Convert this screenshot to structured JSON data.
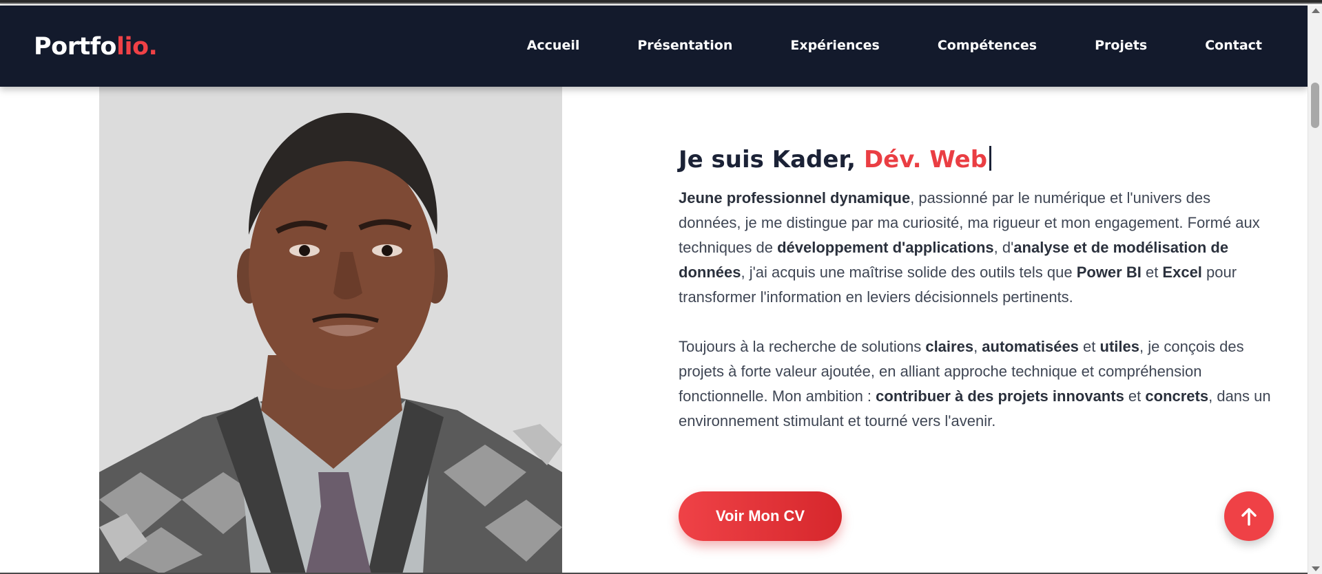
{
  "navbar": {
    "logo_main": "Portfo",
    "logo_accent": "lio.",
    "links": [
      "Accueil",
      "Présentation",
      "Expériences",
      "Compétences",
      "Projets",
      "Contact"
    ]
  },
  "hero": {
    "heading_prefix": "Je suis Kader, ",
    "heading_role": "Dév. Web",
    "paragraph1": [
      {
        "t": "Jeune professionnel dynamique",
        "b": true
      },
      {
        "t": ", passionné par le numérique et l'univers des données, je me distingue par ma curiosité, ma rigueur et mon engagement. Formé aux techniques de ",
        "b": false
      },
      {
        "t": "développement d'applications",
        "b": true
      },
      {
        "t": ", d'",
        "b": false
      },
      {
        "t": "analyse et de modélisation de données",
        "b": true
      },
      {
        "t": ", j'ai acquis une maîtrise solide des outils tels que ",
        "b": false
      },
      {
        "t": "Power BI",
        "b": true
      },
      {
        "t": " et ",
        "b": false
      },
      {
        "t": "Excel",
        "b": true
      },
      {
        "t": " pour transformer l'information en leviers décisionnels pertinents.",
        "b": false
      }
    ],
    "paragraph2": [
      {
        "t": "Toujours à la recherche de solutions ",
        "b": false
      },
      {
        "t": "claires",
        "b": true
      },
      {
        "t": ", ",
        "b": false
      },
      {
        "t": "automatisées",
        "b": true
      },
      {
        "t": " et ",
        "b": false
      },
      {
        "t": "utiles",
        "b": true
      },
      {
        "t": ", je conçois des projets à forte valeur ajoutée, en alliant approche technique et compréhension fonctionnelle. Mon ambition : ",
        "b": false
      },
      {
        "t": "contribuer à des projets innovants",
        "b": true
      },
      {
        "t": " et ",
        "b": false
      },
      {
        "t": "concrets",
        "b": true
      },
      {
        "t": ", dans un environnement stimulant et tourné vers l'avenir.",
        "b": false
      }
    ],
    "cv_button_label": "Voir Mon CV"
  },
  "icons": {
    "back_to_top": "arrow-up-icon"
  },
  "colors": {
    "navbar_bg": "#131a2c",
    "accent": "#ef4146",
    "text": "#3f4654"
  }
}
